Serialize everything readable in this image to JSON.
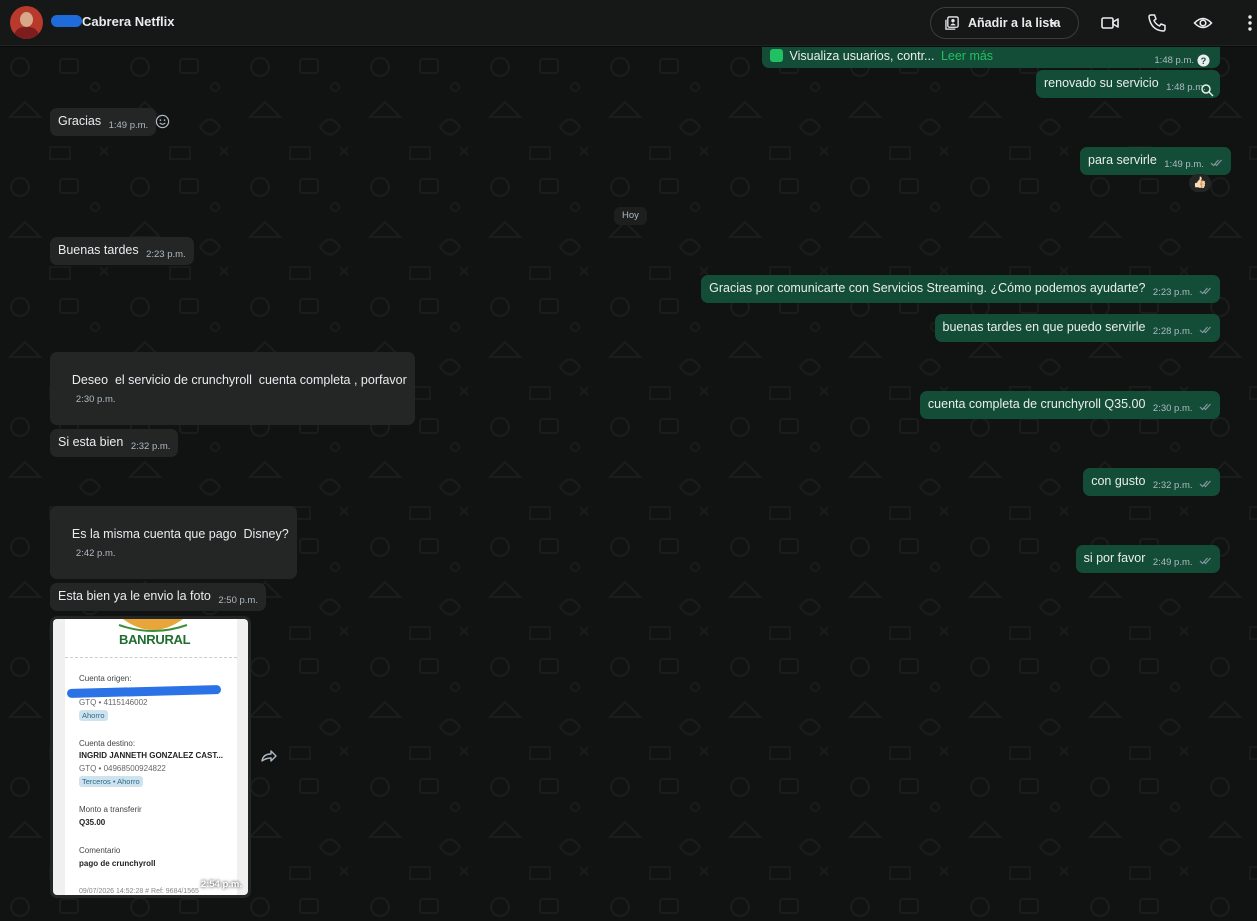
{
  "header": {
    "contact_name": "Cabrera Netflix",
    "add_list_label": "Añadir a la lista",
    "icons": [
      "avatar",
      "add-list-icon",
      "chevron-down-icon",
      "video-call-icon",
      "phone-icon",
      "eye-icon",
      "menu-icon"
    ]
  },
  "chat": {
    "date_separator": "Hoy",
    "messages": [
      {
        "id": "m0",
        "dir": "out",
        "text": "Visualiza usuarios, contr...",
        "link": "Leer más",
        "time": "1:48 p.m."
      },
      {
        "id": "m1",
        "dir": "out",
        "text": "renovado su servicio",
        "time": "1:48 p.m."
      },
      {
        "id": "m2",
        "dir": "in",
        "text": "Gracias",
        "time": "1:49 p.m."
      },
      {
        "id": "m3",
        "dir": "out",
        "text": "para servirle",
        "time": "1:49 p.m.",
        "reaction": "👍🏻"
      },
      {
        "id": "m4",
        "dir": "in",
        "text": "Buenas tardes",
        "time": "2:23 p.m."
      },
      {
        "id": "m5",
        "dir": "out",
        "text": "Gracias por comunicarte con Servicios Streaming. ¿Cómo podemos ayudarte?",
        "time": "2:23 p.m."
      },
      {
        "id": "m6",
        "dir": "out",
        "text": "buenas tardes en que puedo servirle",
        "time": "2:28 p.m."
      },
      {
        "id": "m7",
        "dir": "in",
        "text": "Deseo  el servicio de crunchyroll  cuenta completa , porfavor",
        "time": "2:30 p.m."
      },
      {
        "id": "m8",
        "dir": "out",
        "text": "cuenta completa de crunchyroll Q35.00",
        "time": "2:30 p.m."
      },
      {
        "id": "m9",
        "dir": "in",
        "text": "Si esta bien",
        "time": "2:32 p.m."
      },
      {
        "id": "m10",
        "dir": "out",
        "text": "con gusto",
        "time": "2:32 p.m."
      },
      {
        "id": "m11",
        "dir": "in",
        "text": "Es la misma cuenta que pago  Disney?",
        "time": "2:42 p.m."
      },
      {
        "id": "m12",
        "dir": "out",
        "text": "si por favor",
        "time": "2:49 p.m."
      },
      {
        "id": "m13",
        "dir": "in",
        "text": "Esta bien ya le envio la foto",
        "time": "2:50 p.m."
      }
    ],
    "receipt": {
      "bank_name": "BANRURAL",
      "origin_label": "Cuenta origen:",
      "origin_account": "GTQ • 4115146002",
      "origin_type": "Ahorro",
      "dest_label": "Cuenta destino:",
      "dest_name": "INGRID JANNETH GONZALEZ CAST...",
      "dest_account": "GTQ • 04968500924822",
      "dest_type": "Terceros • Ahorro",
      "amount_label": "Monto a transferir",
      "amount": "Q35.00",
      "comment_label": "Comentario",
      "comment": "pago de crunchyroll",
      "footer": "09/07/2026 14:52:28    # Ref: 9684/1565",
      "time": "2:54 p.m."
    }
  },
  "colors": {
    "header_bg": "#161717",
    "chat_bg": "#111212",
    "incoming_bubble": "#242626",
    "outgoing_bubble": "#144d37",
    "link_green": "#21c063",
    "ticks": "#8696a0"
  }
}
